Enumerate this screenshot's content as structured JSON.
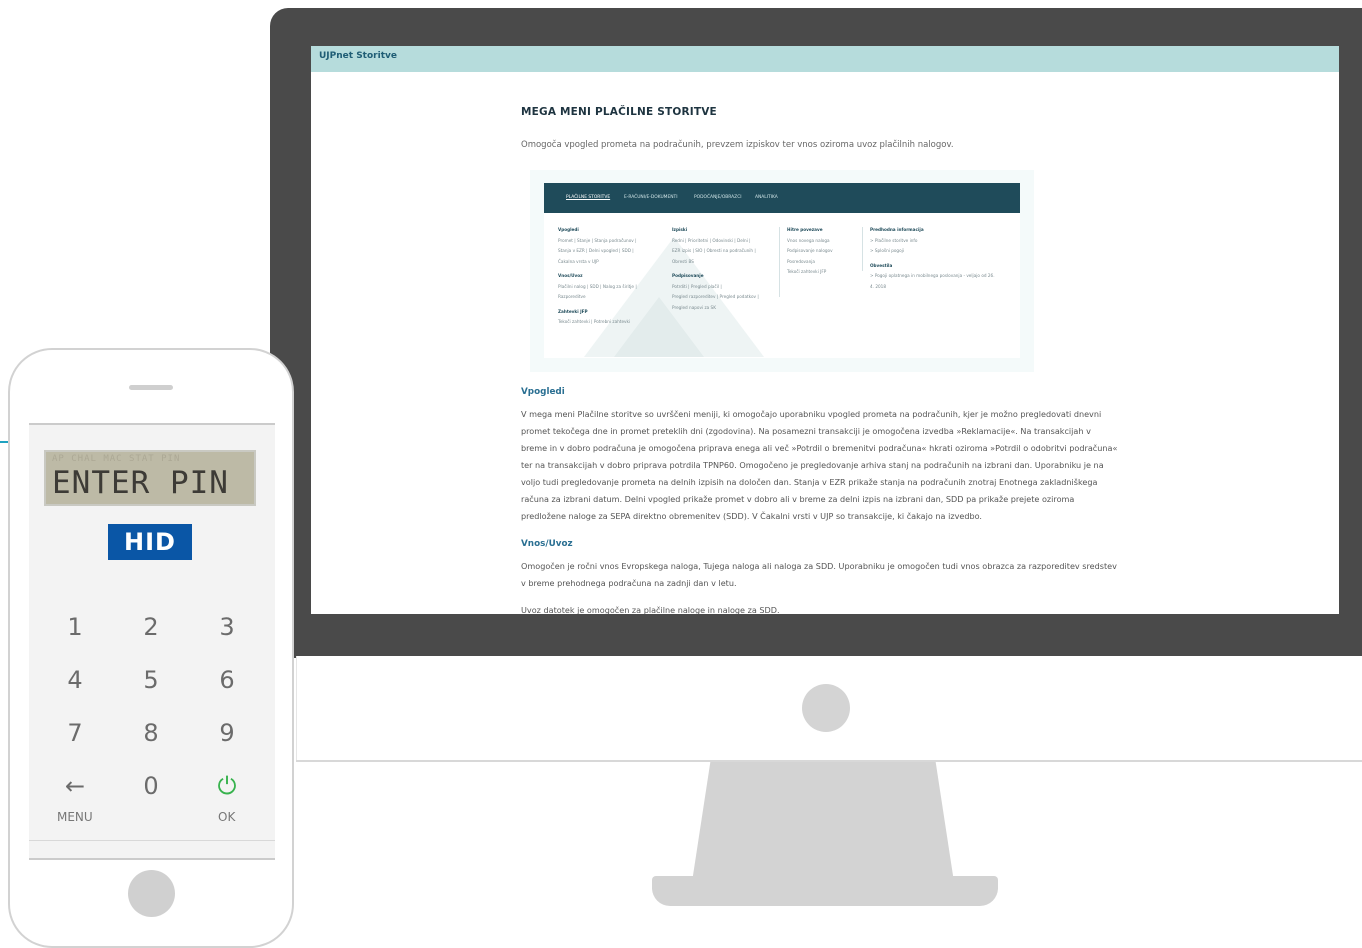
{
  "screen": {
    "app_title": "UJPnet Storitve",
    "page_title": "MEGA MENI PLAČILNE STORITVE",
    "intro": "Omogoča vpogled prometa na podračunih, prevzem izpiskov ter vnos oziroma uvoz plačilnih nalogov.",
    "sections": [
      {
        "heading": "Vpogledi",
        "text": "V mega meni Plačilne storitve so uvrščeni meniji, ki omogočajo uporabniku vpogled prometa na podračunih, kjer je možno pregledovati dnevni promet tekočega dne in promet preteklih dni (zgodovina). Na posamezni transakciji je omogočena izvedba »Reklamacije«. Na transakcijah v breme in v dobro podračuna je omogočena priprava enega ali več »Potrdil o bremenitvi podračuna« hkrati oziroma »Potrdil o odobritvi podračuna« ter na transakcijah v dobro priprava potrdila TPNP60. Omogočeno je pregledovanje arhiva stanj na podračunih na izbrani dan. Uporabniku je na voljo tudi pregledovanje prometa na delnih izpisih na določen dan. Stanja v EZR prikaže stanja na podračunih znotraj Enotnega zakladniškega računa za izbrani datum. Delni vpogled prikaže promet v dobro ali v breme za delni izpis na izbrani dan, SDD pa prikaže prejete oziroma predložene naloge za SEPA direktno obremenitev (SDD). V Čakalni vrsti v UJP so transakcije, ki čakajo na izvedbo."
      },
      {
        "heading": "Vnos/Uvoz",
        "text": "Omogočen je ročni vnos Evropskega naloga, Tujega naloga ali naloga za SDD. Uporabniku je omogočen tudi vnos obrazca za razporeditev sredstev v breme prehodnega podračuna na zadnji dan v letu.",
        "text2": "Uvoz datotek je omogočen za plačilne naloge in naloge za SDD."
      }
    ],
    "mega_menu": {
      "nav": [
        "PLAČILNE STORITVE",
        "E-RAČUNI/E-DOKUMENTI",
        "PODOČANJE/OBRAZCI",
        "ANALITIKA"
      ],
      "col1": [
        {
          "h": "Vpogledi",
          "lines": [
            "Promet | Stanje | Stanja podračunov |",
            "Stanja v EZR | Delni vpogled | SDD |",
            "Čakalna vrsta v UJP"
          ]
        },
        {
          "h": "Vnos/Uvoz",
          "lines": [
            "Plačilni nalog | SDD | Nalog za širitje |",
            "Razporeditve"
          ]
        },
        {
          "h": "Zahtevki JFP",
          "lines": [
            "Tekoči zahtevki | Potrebni zahtevki"
          ]
        }
      ],
      "col2": [
        {
          "h": "Izpiski",
          "lines": [
            "Redni | Prioritetni | Odovinski | Delni |",
            "EZR izpis | SIO | Obresti na podračunih |",
            "Obresti BS"
          ]
        },
        {
          "h": "Podpisovanje",
          "lines": [
            "Potrditi | Pregled plačil |",
            "Pregled razporeditev | Pregled podatkov |",
            "Pregled napovi za SK"
          ]
        }
      ],
      "col3": [
        {
          "h": "Hitre povezave",
          "lines": [
            "Vnos novega naloga",
            "Podpisovanje nalogov",
            "Posredovanja",
            "Tekoči zahtevki JFP"
          ]
        }
      ],
      "col4": [
        {
          "h": "Predhodna informacija",
          "lines": [
            "> Plačilne storitve info",
            "> Splošni pogoji"
          ]
        },
        {
          "h": "Obvestila",
          "lines": [
            "> Pogoji oplatnega in mobilnega poslovanja - veljajo od 26.",
            "   4. 2018"
          ]
        }
      ]
    }
  },
  "token": {
    "lcd_ghost": "AP CHAL MAC STAT PIN",
    "lcd_text": "ENTER PIN",
    "brand": "HID",
    "keys": [
      "1",
      "2",
      "3",
      "4",
      "5",
      "6",
      "7",
      "8",
      "9",
      "←",
      "0",
      "⏻"
    ],
    "menu_label": "MENU",
    "ok_label": "OK"
  },
  "colors": {
    "app_bar": "#b6dcdc",
    "heading_blue": "#2a6f92",
    "menu_nav": "#1f4b5a",
    "hid_blue": "#0a56a6",
    "ok_green": "#37b24d"
  }
}
